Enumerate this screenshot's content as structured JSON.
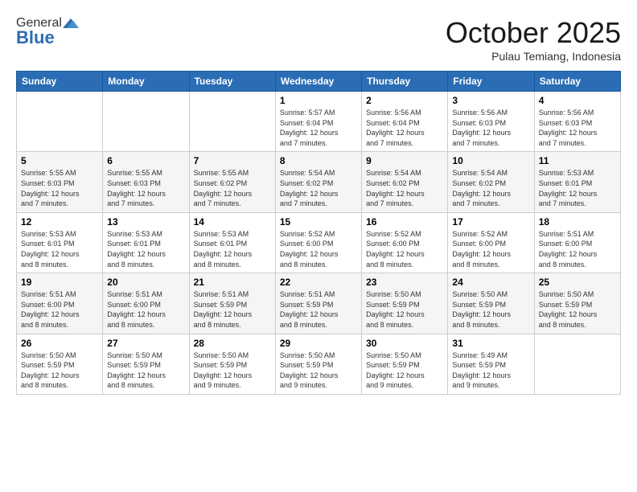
{
  "header": {
    "logo_general": "General",
    "logo_blue": "Blue",
    "title": "October 2025",
    "subtitle": "Pulau Temiang, Indonesia"
  },
  "weekdays": [
    "Sunday",
    "Monday",
    "Tuesday",
    "Wednesday",
    "Thursday",
    "Friday",
    "Saturday"
  ],
  "weeks": [
    [
      {
        "day": "",
        "info": ""
      },
      {
        "day": "",
        "info": ""
      },
      {
        "day": "",
        "info": ""
      },
      {
        "day": "1",
        "info": "Sunrise: 5:57 AM\nSunset: 6:04 PM\nDaylight: 12 hours\nand 7 minutes."
      },
      {
        "day": "2",
        "info": "Sunrise: 5:56 AM\nSunset: 6:04 PM\nDaylight: 12 hours\nand 7 minutes."
      },
      {
        "day": "3",
        "info": "Sunrise: 5:56 AM\nSunset: 6:03 PM\nDaylight: 12 hours\nand 7 minutes."
      },
      {
        "day": "4",
        "info": "Sunrise: 5:56 AM\nSunset: 6:03 PM\nDaylight: 12 hours\nand 7 minutes."
      }
    ],
    [
      {
        "day": "5",
        "info": "Sunrise: 5:55 AM\nSunset: 6:03 PM\nDaylight: 12 hours\nand 7 minutes."
      },
      {
        "day": "6",
        "info": "Sunrise: 5:55 AM\nSunset: 6:03 PM\nDaylight: 12 hours\nand 7 minutes."
      },
      {
        "day": "7",
        "info": "Sunrise: 5:55 AM\nSunset: 6:02 PM\nDaylight: 12 hours\nand 7 minutes."
      },
      {
        "day": "8",
        "info": "Sunrise: 5:54 AM\nSunset: 6:02 PM\nDaylight: 12 hours\nand 7 minutes."
      },
      {
        "day": "9",
        "info": "Sunrise: 5:54 AM\nSunset: 6:02 PM\nDaylight: 12 hours\nand 7 minutes."
      },
      {
        "day": "10",
        "info": "Sunrise: 5:54 AM\nSunset: 6:02 PM\nDaylight: 12 hours\nand 7 minutes."
      },
      {
        "day": "11",
        "info": "Sunrise: 5:53 AM\nSunset: 6:01 PM\nDaylight: 12 hours\nand 7 minutes."
      }
    ],
    [
      {
        "day": "12",
        "info": "Sunrise: 5:53 AM\nSunset: 6:01 PM\nDaylight: 12 hours\nand 8 minutes."
      },
      {
        "day": "13",
        "info": "Sunrise: 5:53 AM\nSunset: 6:01 PM\nDaylight: 12 hours\nand 8 minutes."
      },
      {
        "day": "14",
        "info": "Sunrise: 5:53 AM\nSunset: 6:01 PM\nDaylight: 12 hours\nand 8 minutes."
      },
      {
        "day": "15",
        "info": "Sunrise: 5:52 AM\nSunset: 6:00 PM\nDaylight: 12 hours\nand 8 minutes."
      },
      {
        "day": "16",
        "info": "Sunrise: 5:52 AM\nSunset: 6:00 PM\nDaylight: 12 hours\nand 8 minutes."
      },
      {
        "day": "17",
        "info": "Sunrise: 5:52 AM\nSunset: 6:00 PM\nDaylight: 12 hours\nand 8 minutes."
      },
      {
        "day": "18",
        "info": "Sunrise: 5:51 AM\nSunset: 6:00 PM\nDaylight: 12 hours\nand 8 minutes."
      }
    ],
    [
      {
        "day": "19",
        "info": "Sunrise: 5:51 AM\nSunset: 6:00 PM\nDaylight: 12 hours\nand 8 minutes."
      },
      {
        "day": "20",
        "info": "Sunrise: 5:51 AM\nSunset: 6:00 PM\nDaylight: 12 hours\nand 8 minutes."
      },
      {
        "day": "21",
        "info": "Sunrise: 5:51 AM\nSunset: 5:59 PM\nDaylight: 12 hours\nand 8 minutes."
      },
      {
        "day": "22",
        "info": "Sunrise: 5:51 AM\nSunset: 5:59 PM\nDaylight: 12 hours\nand 8 minutes."
      },
      {
        "day": "23",
        "info": "Sunrise: 5:50 AM\nSunset: 5:59 PM\nDaylight: 12 hours\nand 8 minutes."
      },
      {
        "day": "24",
        "info": "Sunrise: 5:50 AM\nSunset: 5:59 PM\nDaylight: 12 hours\nand 8 minutes."
      },
      {
        "day": "25",
        "info": "Sunrise: 5:50 AM\nSunset: 5:59 PM\nDaylight: 12 hours\nand 8 minutes."
      }
    ],
    [
      {
        "day": "26",
        "info": "Sunrise: 5:50 AM\nSunset: 5:59 PM\nDaylight: 12 hours\nand 8 minutes."
      },
      {
        "day": "27",
        "info": "Sunrise: 5:50 AM\nSunset: 5:59 PM\nDaylight: 12 hours\nand 8 minutes."
      },
      {
        "day": "28",
        "info": "Sunrise: 5:50 AM\nSunset: 5:59 PM\nDaylight: 12 hours\nand 9 minutes."
      },
      {
        "day": "29",
        "info": "Sunrise: 5:50 AM\nSunset: 5:59 PM\nDaylight: 12 hours\nand 9 minutes."
      },
      {
        "day": "30",
        "info": "Sunrise: 5:50 AM\nSunset: 5:59 PM\nDaylight: 12 hours\nand 9 minutes."
      },
      {
        "day": "31",
        "info": "Sunrise: 5:49 AM\nSunset: 5:59 PM\nDaylight: 12 hours\nand 9 minutes."
      },
      {
        "day": "",
        "info": ""
      }
    ]
  ]
}
